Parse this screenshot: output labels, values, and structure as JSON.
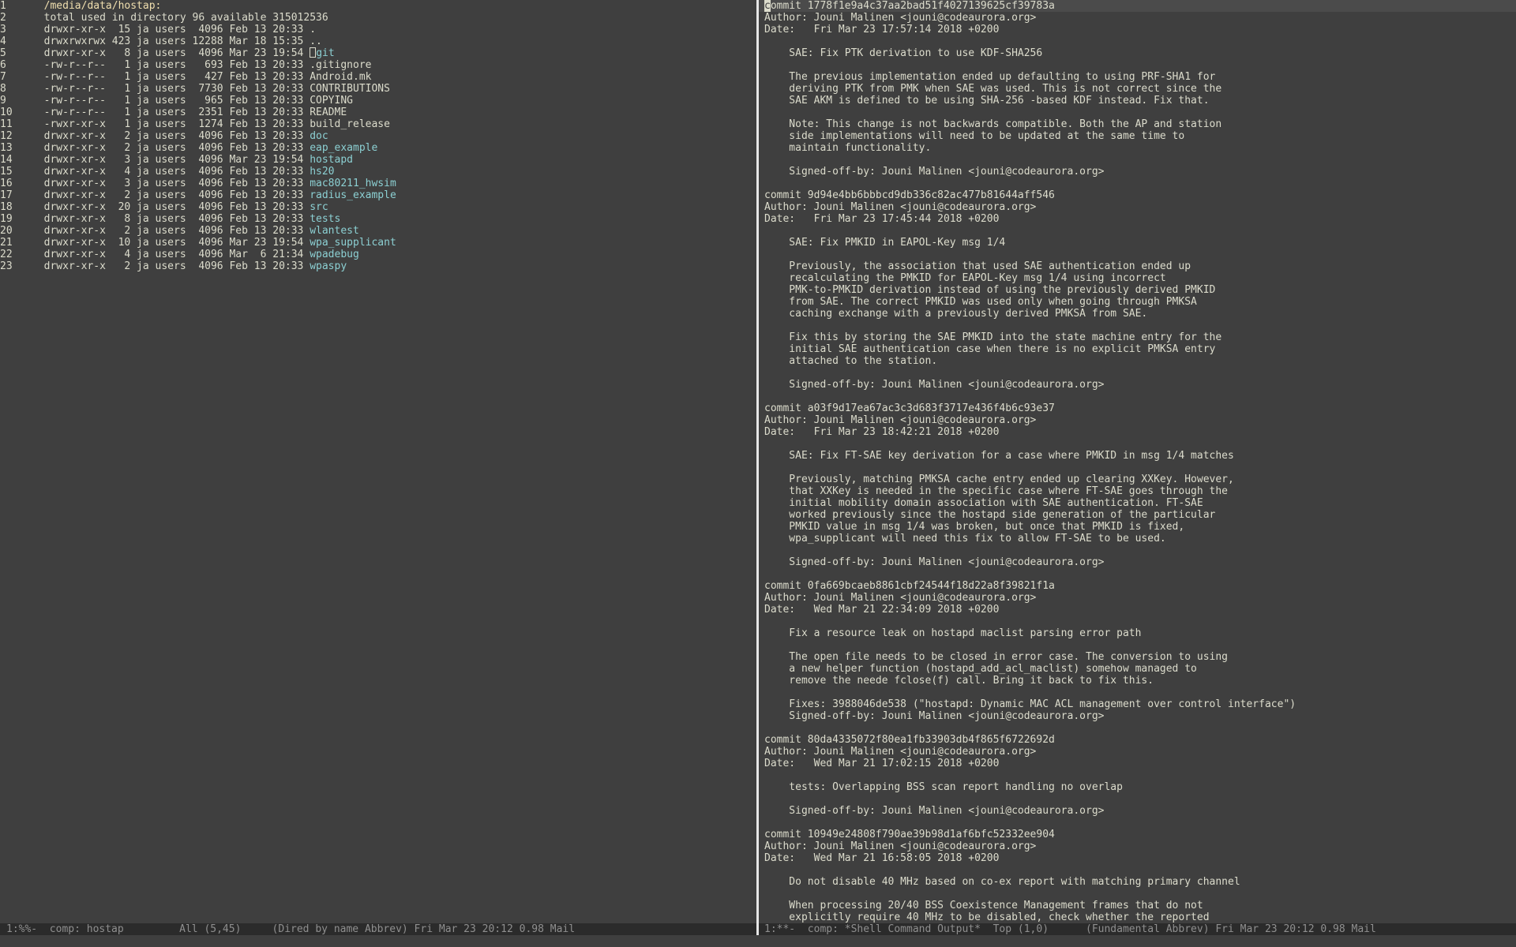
{
  "colors": {
    "background": "#3f3f3f",
    "foreground": "#dcdccc",
    "directory": "#8cd0d3",
    "header": "#f0dfaf",
    "modeline_bg": "#2b2b2b",
    "modeline_fg": "#8f8f8f"
  },
  "dired": {
    "lines": [
      {
        "num": "1",
        "kind": "header",
        "text": "  /media/data/hostap:"
      },
      {
        "num": "2",
        "kind": "plain",
        "text": "  total used in directory 96 available 315012536"
      },
      {
        "num": "3",
        "kind": "entry",
        "meta": "  drwxr-xr-x  15 ja users  4096 Feb 13 20:33 ",
        "name": ".",
        "type": "file"
      },
      {
        "num": "4",
        "kind": "entry",
        "meta": "  drwxrwxrwx 423 ja users 12288 Mar 18 15:35 ",
        "name": "..",
        "type": "file"
      },
      {
        "num": "5",
        "kind": "entry",
        "meta": "  drwxr-xr-x   8 ja users  4096 Mar 23 19:54 ",
        "name": ".git",
        "type": "dir",
        "cursor": true
      },
      {
        "num": "6",
        "kind": "entry",
        "meta": "  -rw-r--r--   1 ja users   693 Feb 13 20:33 ",
        "name": ".gitignore",
        "type": "file"
      },
      {
        "num": "7",
        "kind": "entry",
        "meta": "  -rw-r--r--   1 ja users   427 Feb 13 20:33 ",
        "name": "Android.mk",
        "type": "file"
      },
      {
        "num": "8",
        "kind": "entry",
        "meta": "  -rw-r--r--   1 ja users  7730 Feb 13 20:33 ",
        "name": "CONTRIBUTIONS",
        "type": "file"
      },
      {
        "num": "9",
        "kind": "entry",
        "meta": "  -rw-r--r--   1 ja users   965 Feb 13 20:33 ",
        "name": "COPYING",
        "type": "file"
      },
      {
        "num": "10",
        "kind": "entry",
        "meta": "  -rw-r--r--   1 ja users  2351 Feb 13 20:33 ",
        "name": "README",
        "type": "file"
      },
      {
        "num": "11",
        "kind": "entry",
        "meta": "  -rwxr-xr-x   1 ja users  1274 Feb 13 20:33 ",
        "name": "build_release",
        "type": "file"
      },
      {
        "num": "12",
        "kind": "entry",
        "meta": "  drwxr-xr-x   2 ja users  4096 Feb 13 20:33 ",
        "name": "doc",
        "type": "dir"
      },
      {
        "num": "13",
        "kind": "entry",
        "meta": "  drwxr-xr-x   2 ja users  4096 Feb 13 20:33 ",
        "name": "eap_example",
        "type": "dir"
      },
      {
        "num": "14",
        "kind": "entry",
        "meta": "  drwxr-xr-x   3 ja users  4096 Mar 23 19:54 ",
        "name": "hostapd",
        "type": "dir"
      },
      {
        "num": "15",
        "kind": "entry",
        "meta": "  drwxr-xr-x   4 ja users  4096 Feb 13 20:33 ",
        "name": "hs20",
        "type": "dir"
      },
      {
        "num": "16",
        "kind": "entry",
        "meta": "  drwxr-xr-x   3 ja users  4096 Feb 13 20:33 ",
        "name": "mac80211_hwsim",
        "type": "dir"
      },
      {
        "num": "17",
        "kind": "entry",
        "meta": "  drwxr-xr-x   2 ja users  4096 Feb 13 20:33 ",
        "name": "radius_example",
        "type": "dir"
      },
      {
        "num": "18",
        "kind": "entry",
        "meta": "  drwxr-xr-x  20 ja users  4096 Feb 13 20:33 ",
        "name": "src",
        "type": "dir"
      },
      {
        "num": "19",
        "kind": "entry",
        "meta": "  drwxr-xr-x   8 ja users  4096 Feb 13 20:33 ",
        "name": "tests",
        "type": "dir"
      },
      {
        "num": "20",
        "kind": "entry",
        "meta": "  drwxr-xr-x   2 ja users  4096 Feb 13 20:33 ",
        "name": "wlantest",
        "type": "dir"
      },
      {
        "num": "21",
        "kind": "entry",
        "meta": "  drwxr-xr-x  10 ja users  4096 Mar 23 19:54 ",
        "name": "wpa_supplicant",
        "type": "dir"
      },
      {
        "num": "22",
        "kind": "entry",
        "meta": "  drwxr-xr-x   4 ja users  4096 Mar  6 21:34 ",
        "name": "wpadebug",
        "type": "dir"
      },
      {
        "num": "23",
        "kind": "entry",
        "meta": "  drwxr-xr-x   2 ja users  4096 Feb 13 20:33 ",
        "name": "wpaspy",
        "type": "dir"
      }
    ],
    "modeline": "1:%%-  comp: hostap         All (5,45)     (Dired by name Abbrev) Fri Mar 23 20:12 0.98 Mail"
  },
  "git_log": {
    "lines": [
      "commit 1778f1e9a4c37aa2bad51f4027139625cf39783a",
      "Author: Jouni Malinen <jouni@codeaurora.org>",
      "Date:   Fri Mar 23 17:57:14 2018 +0200",
      "",
      "    SAE: Fix PTK derivation to use KDF-SHA256",
      "",
      "    The previous implementation ended up defaulting to using PRF-SHA1 for",
      "    deriving PTK from PMK when SAE was used. This is not correct since the",
      "    SAE AKM is defined to be using SHA-256 -based KDF instead. Fix that.",
      "",
      "    Note: This change is not backwards compatible. Both the AP and station",
      "    side implementations will need to be updated at the same time to",
      "    maintain functionality.",
      "",
      "    Signed-off-by: Jouni Malinen <jouni@codeaurora.org>",
      "",
      "commit 9d94e4bb6bbbcd9db336c82ac477b81644aff546",
      "Author: Jouni Malinen <jouni@codeaurora.org>",
      "Date:   Fri Mar 23 17:45:44 2018 +0200",
      "",
      "    SAE: Fix PMKID in EAPOL-Key msg 1/4",
      "",
      "    Previously, the association that used SAE authentication ended up",
      "    recalculating the PMKID for EAPOL-Key msg 1/4 using incorrect",
      "    PMK-to-PMKID derivation instead of using the previously derived PMKID",
      "    from SAE. The correct PMKID was used only when going through PMKSA",
      "    caching exchange with a previously derived PMKSA from SAE.",
      "",
      "    Fix this by storing the SAE PMKID into the state machine entry for the",
      "    initial SAE authentication case when there is no explicit PMKSA entry",
      "    attached to the station.",
      "",
      "    Signed-off-by: Jouni Malinen <jouni@codeaurora.org>",
      "",
      "commit a03f9d17ea67ac3c3d683f3717e436f4b6c93e37",
      "Author: Jouni Malinen <jouni@codeaurora.org>",
      "Date:   Fri Mar 23 18:42:21 2018 +0200",
      "",
      "    SAE: Fix FT-SAE key derivation for a case where PMKID in msg 1/4 matches",
      "",
      "    Previously, matching PMKSA cache entry ended up clearing XXKey. However,",
      "    that XXKey is needed in the specific case where FT-SAE goes through the",
      "    initial mobility domain association with SAE authentication. FT-SAE",
      "    worked previously since the hostapd side generation of the particular",
      "    PMKID value in msg 1/4 was broken, but once that PMKID is fixed,",
      "    wpa_supplicant will need this fix to allow FT-SAE to be used.",
      "",
      "    Signed-off-by: Jouni Malinen <jouni@codeaurora.org>",
      "",
      "commit 0fa669bcaeb8861cbf24544f18d22a8f39821f1a",
      "Author: Jouni Malinen <jouni@codeaurora.org>",
      "Date:   Wed Mar 21 22:34:09 2018 +0200",
      "",
      "    Fix a resource leak on hostapd maclist parsing error path",
      "",
      "    The open file needs to be closed in error case. The conversion to using",
      "    a new helper function (hostapd_add_acl_maclist) somehow managed to",
      "    remove the neede fclose(f) call. Bring it back to fix this.",
      "",
      "    Fixes: 3988046de538 (\"hostapd: Dynamic MAC ACL management over control interface\")",
      "    Signed-off-by: Jouni Malinen <jouni@codeaurora.org>",
      "",
      "commit 80da4335072f80ea1fb33903db4f865f6722692d",
      "Author: Jouni Malinen <jouni@codeaurora.org>",
      "Date:   Wed Mar 21 17:02:15 2018 +0200",
      "",
      "    tests: Overlapping BSS scan report handling no overlap",
      "",
      "    Signed-off-by: Jouni Malinen <jouni@codeaurora.org>",
      "",
      "commit 10949e24808f790ae39b98d1af6bfc52332ee904",
      "Author: Jouni Malinen <jouni@codeaurora.org>",
      "Date:   Wed Mar 21 16:58:05 2018 +0200",
      "",
      "    Do not disable 40 MHz based on co-ex report with matching primary channel",
      "",
      "    When processing 20/40 BSS Coexistence Management frames that do not",
      "    explicitly require 40 MHz to be disabled, check whether the reported"
    ],
    "modeline": "1:**-  comp: *Shell Command Output*  Top (1,0)      (Fundamental Abbrev) Fri Mar 23 20:12 0.98 Mail"
  }
}
